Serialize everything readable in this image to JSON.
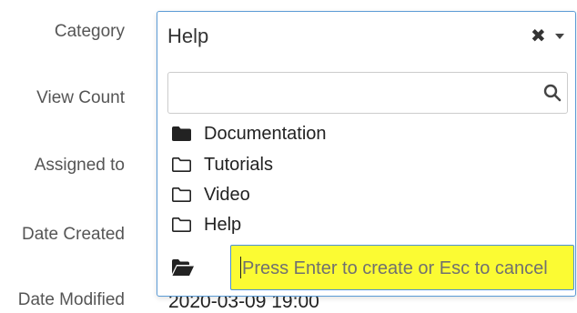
{
  "form": {
    "labels": {
      "category": "Category",
      "view_count": "View Count",
      "assigned_to": "Assigned to",
      "date_created": "Date Created",
      "date_modified": "Date Modified"
    },
    "date_modified_value": "2020-03-09 19:00"
  },
  "category_select": {
    "selected_value": "Help",
    "clear_glyph": "✖",
    "search": {
      "value": "",
      "placeholder": ""
    },
    "options": [
      {
        "label": "Documentation",
        "icon": "folder-solid-icon"
      },
      {
        "label": "Tutorials",
        "icon": "folder-outline-icon"
      },
      {
        "label": "Video",
        "icon": "folder-outline-icon"
      },
      {
        "label": "Help",
        "icon": "folder-outline-icon"
      }
    ],
    "create": {
      "icon": "folder-open-icon",
      "placeholder": "Press Enter to create or Esc to cancel",
      "value": ""
    }
  },
  "colors": {
    "focus_border": "#5b9bd5",
    "create_highlight": "#fbfb33"
  }
}
